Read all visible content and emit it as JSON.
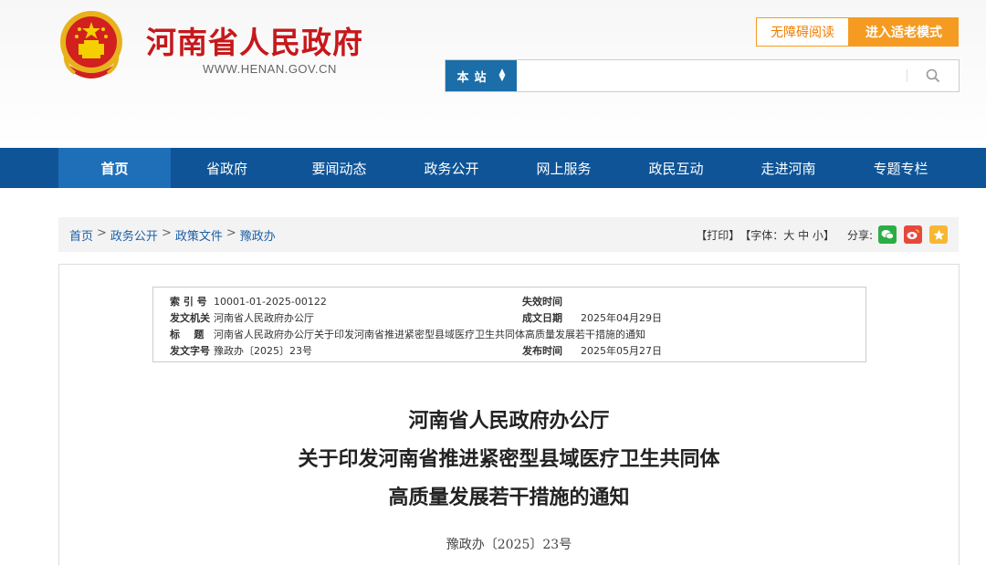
{
  "header": {
    "site_title": "河南省人民政府",
    "site_url": "WWW.HENAN.GOV.CN",
    "btn_accessible": "无障碍阅读",
    "btn_elder": "进入适老模式",
    "search_scope": "本站",
    "search_placeholder": "",
    "colors": {
      "brand_red": "#c6181b",
      "nav_blue": "#0e5497",
      "accent_orange": "#f59b22"
    }
  },
  "nav": {
    "items": [
      "首页",
      "省政府",
      "要闻动态",
      "政务公开",
      "网上服务",
      "政民互动",
      "走进河南",
      "专题专栏"
    ],
    "active_index": 0
  },
  "breadcrumb": {
    "items": [
      "首页",
      "政务公开",
      "政策文件",
      "豫政办"
    ],
    "separator": ">"
  },
  "tools": {
    "print": "【打印】",
    "font": "【字体：",
    "font_large": "大",
    "font_mid": "中",
    "font_small": "小",
    "font_end": "】",
    "share": "分享:",
    "share_icons": [
      "wechat-icon",
      "weibo-icon",
      "favorite-icon"
    ]
  },
  "meta": {
    "index_label": "索 引 号",
    "index_value": "10001-01-2025-00122",
    "expire_label": "失效时间",
    "expire_value": "",
    "issuer_label": "发文机关",
    "issuer_value": "河南省人民政府办公厅",
    "created_label": "成文日期",
    "created_value": "2025年04月29日",
    "title_label": "标    题",
    "title_value": "河南省人民政府办公厅关于印发河南省推进紧密型县域医疗卫生共同体高质量发展若干措施的通知",
    "docno_label": "发文字号",
    "docno_value": "豫政办〔2025〕23号",
    "publish_label": "发布时间",
    "publish_value": "2025年05月27日"
  },
  "document": {
    "title_line1": "河南省人民政府办公厅",
    "title_line2": "关于印发河南省推进紧密型县域医疗卫生共同体",
    "title_line3": "高质量发展若干措施的通知",
    "doc_number": "豫政办〔2025〕23号"
  }
}
